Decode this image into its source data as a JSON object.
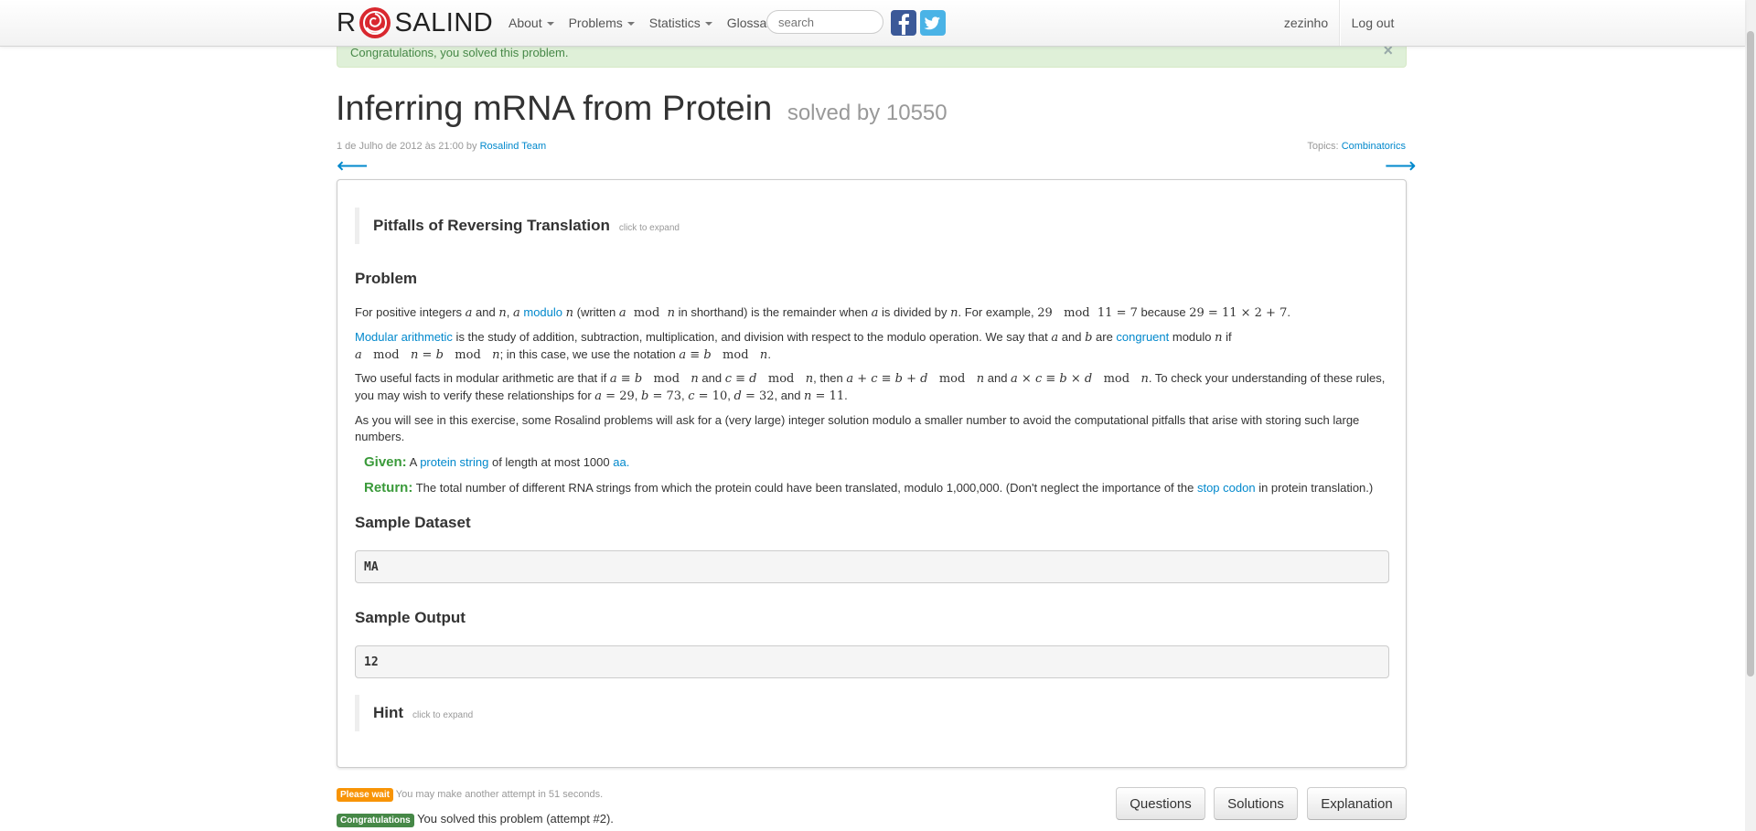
{
  "navbar": {
    "brand_left": "R",
    "brand_right": "SALIND",
    "items": [
      {
        "label": "About",
        "dropdown": true
      },
      {
        "label": "Problems",
        "dropdown": true
      },
      {
        "label": "Statistics",
        "dropdown": true
      },
      {
        "label": "Glossary",
        "dropdown": false
      }
    ],
    "search_placeholder": "search",
    "social": [
      "facebook-icon",
      "twitter-icon"
    ],
    "user": "zezinho",
    "logout": "Log out"
  },
  "alert": {
    "message": "Congratulations, you solved this problem.",
    "close": "×"
  },
  "problem": {
    "title": "Inferring mRNA from Protein",
    "solved_by": "solved by 10550",
    "date": "1 de Julho de 2012 às 21:00",
    "by": "by",
    "author": "Rosalind Team",
    "topics_label": "Topics:",
    "topic": "Combinatorics",
    "prev_arrow": "⟵",
    "next_arrow": "⟶",
    "intro_title": "Pitfalls of Reversing Translation",
    "click_to_expand": "click to expand",
    "problem_heading": "Problem",
    "given_label": "Given:",
    "given_text_1": "A",
    "given_link": "protein string",
    "given_text_2": "of length at most 1000",
    "given_unit": "aa.",
    "return_label": "Return:",
    "return_text_1": "The total number of different RNA strings from which the protein could have been translated, modulo 1,000,000. (Don't neglect the importance of the",
    "return_link": "stop codon",
    "return_text_2": "in protein translation.)",
    "sample_dataset_heading": "Sample Dataset",
    "sample_dataset": "MA",
    "sample_output_heading": "Sample Output",
    "sample_output": "12",
    "hint_title": "Hint"
  },
  "status": {
    "wait_badge": "Please wait",
    "wait_text": "You may make another attempt in 51 seconds.",
    "congrats_badge": "Congratulations",
    "congrats_text": "You solved this problem (attempt #2).",
    "wait_color": "#f89406",
    "congrats_color": "#468847"
  },
  "buttons": {
    "questions": "Questions",
    "solutions": "Solutions",
    "explanation": "Explanation"
  },
  "colors": {
    "link": "#0088cc",
    "given_return": "#3a9a3a",
    "alert_bg": "#dff0d8"
  }
}
